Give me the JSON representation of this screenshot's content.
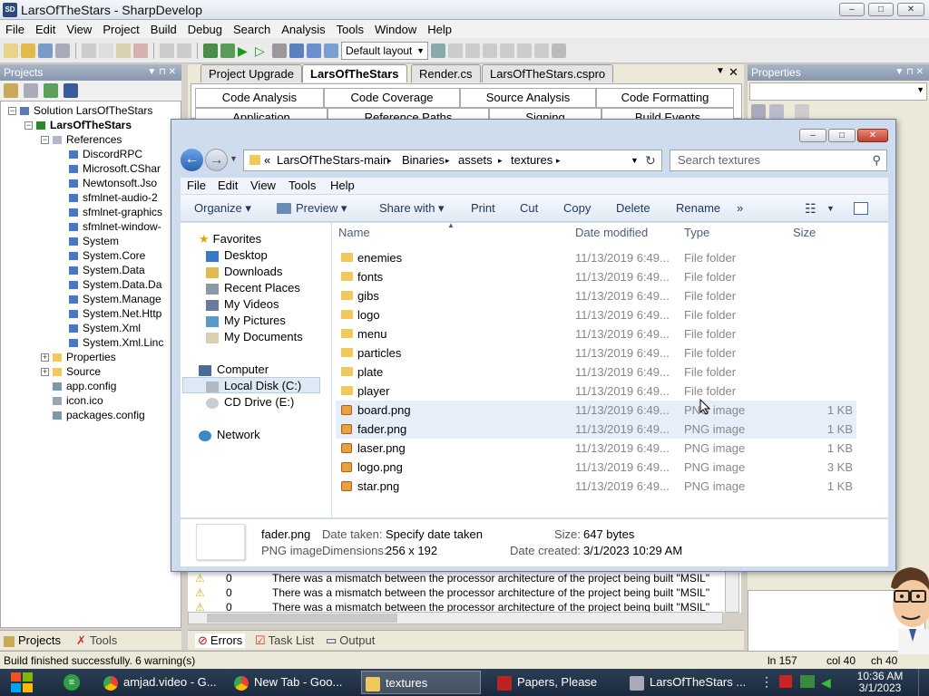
{
  "app": {
    "title": "LarsOfTheStars - SharpDevelop",
    "menu": [
      "File",
      "Edit",
      "View",
      "Project",
      "Build",
      "Debug",
      "Search",
      "Analysis",
      "Tools",
      "Window",
      "Help"
    ],
    "layout_combo": "Default layout",
    "window_buttons": {
      "minimize": "–",
      "maximize": "□",
      "close": "✕"
    }
  },
  "projects_panel": {
    "title": "Projects",
    "pin": "▼ ⊓ ✕",
    "items": [
      {
        "label": "Solution LarsOfTheStars",
        "indent": 0,
        "expander": "−",
        "icon": "solution"
      },
      {
        "label": "LarsOfTheStars",
        "indent": 1,
        "expander": "−",
        "icon": "project",
        "bold": true
      },
      {
        "label": "References",
        "indent": 2,
        "expander": "−",
        "icon": "refs"
      },
      {
        "label": "DiscordRPC",
        "indent": 3,
        "icon": "ref"
      },
      {
        "label": "Microsoft.CShar",
        "indent": 3,
        "icon": "ref"
      },
      {
        "label": "Newtonsoft.Jso",
        "indent": 3,
        "icon": "ref"
      },
      {
        "label": "sfmlnet-audio-2",
        "indent": 3,
        "icon": "ref"
      },
      {
        "label": "sfmlnet-graphics",
        "indent": 3,
        "icon": "ref"
      },
      {
        "label": "sfmlnet-window-",
        "indent": 3,
        "icon": "ref"
      },
      {
        "label": "System",
        "indent": 3,
        "icon": "ref"
      },
      {
        "label": "System.Core",
        "indent": 3,
        "icon": "ref"
      },
      {
        "label": "System.Data",
        "indent": 3,
        "icon": "ref"
      },
      {
        "label": "System.Data.Da",
        "indent": 3,
        "icon": "ref"
      },
      {
        "label": "System.Manage",
        "indent": 3,
        "icon": "ref"
      },
      {
        "label": "System.Net.Http",
        "indent": 3,
        "icon": "ref"
      },
      {
        "label": "System.Xml",
        "indent": 3,
        "icon": "ref"
      },
      {
        "label": "System.Xml.Linc",
        "indent": 3,
        "icon": "ref"
      },
      {
        "label": "Properties",
        "indent": 2,
        "expander": "+",
        "icon": "folder"
      },
      {
        "label": "Source",
        "indent": 2,
        "expander": "+",
        "icon": "folder"
      },
      {
        "label": "app.config",
        "indent": 2,
        "icon": "config"
      },
      {
        "label": "icon.ico",
        "indent": 2,
        "icon": "ico"
      },
      {
        "label": "packages.config",
        "indent": 2,
        "icon": "config"
      }
    ],
    "bottom_tabs": [
      "Projects",
      "Tools"
    ]
  },
  "doc_tabs": [
    "Project Upgrade",
    "LarsOfTheStars",
    "Render.cs",
    "LarsOfTheStars.cspro"
  ],
  "doc_tab_close": "✕",
  "doc_tab_arrow": "▼",
  "project_options_tabs_row1": [
    "Code Analysis",
    "Code Coverage",
    "Source Analysis",
    "Code Formatting"
  ],
  "project_options_tabs_row2": [
    "Application",
    "Reference Paths",
    "Signing",
    "Build Events"
  ],
  "properties_panel": {
    "title": "Properties",
    "pin": "▼ ⊓ ✕"
  },
  "explorer": {
    "window_buttons": {
      "minimize": "–",
      "maximize": "□",
      "close": "✕"
    },
    "breadcrumb": [
      "«",
      "LarsOfTheStars-main",
      "Binaries",
      "assets",
      "textures"
    ],
    "search_placeholder": "Search textures",
    "menu": [
      "File",
      "Edit",
      "View",
      "Tools",
      "Help"
    ],
    "commands": [
      "Organize ▾",
      "Preview ▾",
      "Share with ▾",
      "Print",
      "Cut",
      "Copy",
      "Delete",
      "Rename",
      "»"
    ],
    "columns": [
      "Name",
      "Date modified",
      "Type",
      "Size"
    ],
    "nav": {
      "favorites_label": "Favorites",
      "favorites": [
        "Desktop",
        "Downloads",
        "Recent Places",
        "My Videos",
        "My Pictures",
        "My Documents"
      ],
      "computer_label": "Computer",
      "drives": [
        "Local Disk (C:)",
        "CD Drive (E:)"
      ],
      "network_label": "Network"
    },
    "files": [
      {
        "name": "enemies",
        "date": "11/13/2019 6:49...",
        "type": "File folder",
        "size": "",
        "kind": "folder"
      },
      {
        "name": "fonts",
        "date": "11/13/2019 6:49...",
        "type": "File folder",
        "size": "",
        "kind": "folder"
      },
      {
        "name": "gibs",
        "date": "11/13/2019 6:49...",
        "type": "File folder",
        "size": "",
        "kind": "folder"
      },
      {
        "name": "logo",
        "date": "11/13/2019 6:49...",
        "type": "File folder",
        "size": "",
        "kind": "folder"
      },
      {
        "name": "menu",
        "date": "11/13/2019 6:49...",
        "type": "File folder",
        "size": "",
        "kind": "folder"
      },
      {
        "name": "particles",
        "date": "11/13/2019 6:49...",
        "type": "File folder",
        "size": "",
        "kind": "folder"
      },
      {
        "name": "plate",
        "date": "11/13/2019 6:49...",
        "type": "File folder",
        "size": "",
        "kind": "folder"
      },
      {
        "name": "player",
        "date": "11/13/2019 6:49...",
        "type": "File folder",
        "size": "",
        "kind": "folder"
      },
      {
        "name": "board.png",
        "date": "11/13/2019 6:49...",
        "type": "PNG image",
        "size": "1 KB",
        "kind": "png",
        "hover": true
      },
      {
        "name": "fader.png",
        "date": "11/13/2019 6:49...",
        "type": "PNG image",
        "size": "1 KB",
        "kind": "png",
        "selected": true
      },
      {
        "name": "laser.png",
        "date": "11/13/2019 6:49...",
        "type": "PNG image",
        "size": "1 KB",
        "kind": "png"
      },
      {
        "name": "logo.png",
        "date": "11/13/2019 6:49...",
        "type": "PNG image",
        "size": "3 KB",
        "kind": "png"
      },
      {
        "name": "star.png",
        "date": "11/13/2019 6:49...",
        "type": "PNG image",
        "size": "1 KB",
        "kind": "png"
      }
    ],
    "details": {
      "filename": "fader.png",
      "filetype": "PNG image",
      "date_taken_label": "Date taken:",
      "date_taken_value": "Specify date taken",
      "dimensions_label": "Dimensions:",
      "dimensions_value": "256 x 192",
      "size_label": "Size:",
      "size_value": "647 bytes",
      "created_label": "Date created:",
      "created_value": "3/1/2023 10:29 AM"
    }
  },
  "errors": {
    "rows": [
      {
        "num": "0",
        "text": "There was a mismatch between the processor architecture of the project being built \"MSIL\""
      },
      {
        "num": "0",
        "text": "There was a mismatch between the processor architecture of the project being built \"MSIL\""
      },
      {
        "num": "0",
        "text": "There was a mismatch between the processor architecture of the project being built \"MSIL\""
      }
    ],
    "tabs": [
      "Errors",
      "Task List",
      "Output"
    ]
  },
  "statusbar": {
    "message": "Build finished successfully. 6 warning(s)",
    "line": "ln 157",
    "col": "col 40",
    "ch": "ch 40"
  },
  "taskbar": {
    "items": [
      "amjad.video - G...",
      "New Tab - Goo...",
      "textures",
      "Papers, Please",
      "LarsOfTheStars ..."
    ],
    "time": "10:36 AM",
    "date": "3/1/2023"
  },
  "colors": {
    "accent": "#3a78c8",
    "taskbar": "#1a2a3e",
    "selection": "#e5eef9"
  }
}
